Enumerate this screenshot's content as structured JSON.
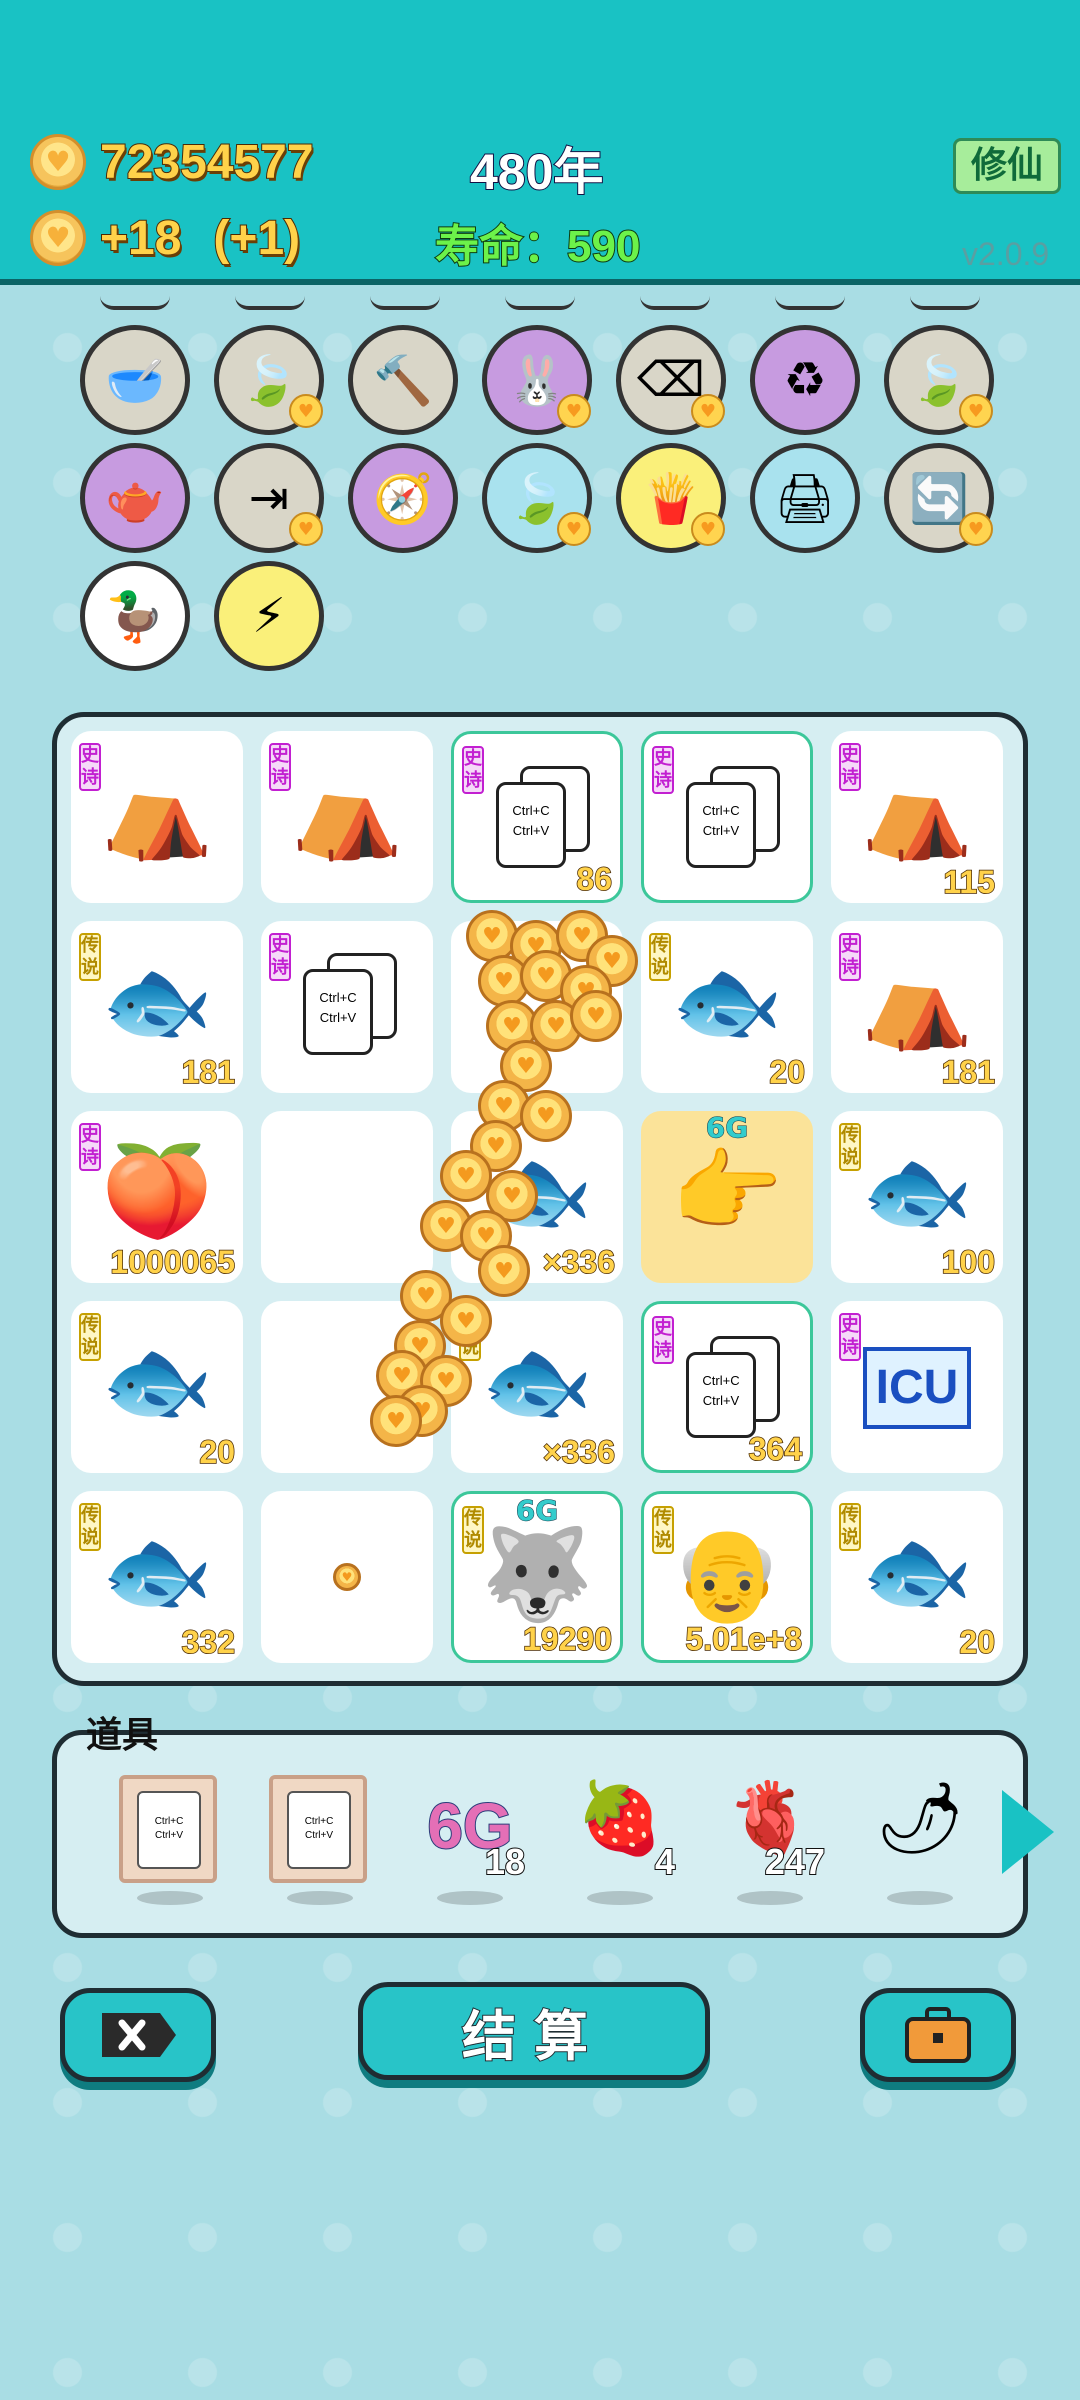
{
  "header": {
    "coins": "72354577",
    "income": "+18",
    "income_bonus": "(+1)",
    "year": "480年",
    "lifespan_label": "寿命：",
    "lifespan_value": "590",
    "cultivate_button": "修仙",
    "version": "v2.0.9"
  },
  "abilities": [
    {
      "name": "pet-food-bowl-icon",
      "glyph": "🥣",
      "color": "gray",
      "badge": false
    },
    {
      "name": "leaf-icon",
      "glyph": "🍃",
      "color": "gray",
      "badge": true
    },
    {
      "name": "hammer-icon",
      "glyph": "🔨",
      "color": "gray",
      "badge": false
    },
    {
      "name": "rabbit-icon",
      "glyph": "🐰",
      "color": "purple",
      "badge": true
    },
    {
      "name": "delete-key-icon",
      "glyph": "⌫",
      "color": "gray",
      "badge": true
    },
    {
      "name": "recycle-icon",
      "glyph": "♻",
      "color": "purple",
      "badge": false
    },
    {
      "name": "leaf-icon",
      "glyph": "🍃",
      "color": "gray",
      "badge": true
    },
    {
      "name": "gravy-boat-icon",
      "glyph": "🫖",
      "color": "purple",
      "badge": false
    },
    {
      "name": "skip-icon",
      "glyph": "⇥",
      "color": "gray",
      "badge": true
    },
    {
      "name": "compass-icon",
      "glyph": "🧭",
      "color": "purple",
      "badge": false
    },
    {
      "name": "leaf-icon",
      "glyph": "🍃",
      "color": "blue",
      "badge": true
    },
    {
      "name": "fries-icon",
      "glyph": "🍟",
      "color": "yellow",
      "badge": true
    },
    {
      "name": "printer-icon",
      "glyph": "🖨",
      "color": "blue",
      "badge": false
    },
    {
      "name": "refresh-icon",
      "glyph": "🔄",
      "color": "gray",
      "badge": true
    },
    {
      "name": "duck-pot-icon",
      "glyph": "🦆",
      "color": "white",
      "badge": false
    },
    {
      "name": "lightning-icon",
      "glyph": "⚡",
      "color": "yellow",
      "badge": false
    }
  ],
  "tags": {
    "epic": "史诗",
    "legend": "传说"
  },
  "copy_text": {
    "line1": "Ctrl+C",
    "line2": "Ctrl+V"
  },
  "board": [
    {
      "type": "house",
      "tag": "epic",
      "count": "",
      "green": false
    },
    {
      "type": "house",
      "tag": "epic",
      "count": "",
      "green": false
    },
    {
      "type": "copy",
      "tag": "epic",
      "count": "86",
      "green": true
    },
    {
      "type": "copy",
      "tag": "epic",
      "count": "",
      "green": true
    },
    {
      "type": "house",
      "tag": "epic",
      "count": "115",
      "green": false
    },
    {
      "type": "fish",
      "tag": "legend",
      "count": "181",
      "green": false
    },
    {
      "type": "copy",
      "tag": "epic",
      "count": "",
      "green": false
    },
    {
      "type": "coins",
      "tag": "",
      "count": "",
      "green": false
    },
    {
      "type": "fish",
      "tag": "legend",
      "count": "20",
      "green": false
    },
    {
      "type": "house",
      "tag": "epic",
      "count": "181",
      "green": false
    },
    {
      "type": "peach",
      "tag": "epic",
      "count": "1000065",
      "green": false
    },
    {
      "type": "empty",
      "tag": "",
      "count": "",
      "green": false
    },
    {
      "type": "fish",
      "tag": "",
      "count": "×336",
      "green": false
    },
    {
      "type": "pointer",
      "tag": "",
      "count": "",
      "green": false,
      "label": "6G"
    },
    {
      "type": "fish",
      "tag": "legend",
      "count": "100",
      "green": false
    },
    {
      "type": "fish",
      "tag": "legend",
      "count": "20",
      "green": false
    },
    {
      "type": "empty",
      "tag": "",
      "count": "",
      "green": false
    },
    {
      "type": "fish",
      "tag": "legend",
      "count": "×336",
      "green": false
    },
    {
      "type": "copy",
      "tag": "epic",
      "count": "364",
      "green": true
    },
    {
      "type": "icu",
      "tag": "epic",
      "count": "",
      "green": false,
      "label": "ICU"
    },
    {
      "type": "fish",
      "tag": "legend",
      "count": "332",
      "green": false
    },
    {
      "type": "smallcoin",
      "tag": "",
      "count": "",
      "green": false
    },
    {
      "type": "husky",
      "tag": "legend",
      "count": "19290",
      "green": true,
      "label": "6G"
    },
    {
      "type": "oldman",
      "tag": "legend",
      "count": "5.01e+8",
      "green": true
    },
    {
      "type": "fish",
      "tag": "legend",
      "count": "20",
      "green": false
    }
  ],
  "items_panel": {
    "title": "道具",
    "items": [
      {
        "name": "copy-frame-item",
        "glyph": "",
        "count": ""
      },
      {
        "name": "copy-frame-item",
        "glyph": "",
        "count": ""
      },
      {
        "name": "6g-item",
        "glyph": "6G",
        "count": "18"
      },
      {
        "name": "strawberry-item",
        "glyph": "🍓",
        "count": "4"
      },
      {
        "name": "liver-item",
        "glyph": "🫀",
        "count": "247"
      },
      {
        "name": "chili-item",
        "glyph": "🌶",
        "count": ""
      }
    ]
  },
  "buttons": {
    "settle": "结算"
  },
  "colors": {
    "header": "#19c2c4",
    "background": "#a9dde4",
    "coin_text": "#ffd24a",
    "life_text": "#6cf24a"
  }
}
